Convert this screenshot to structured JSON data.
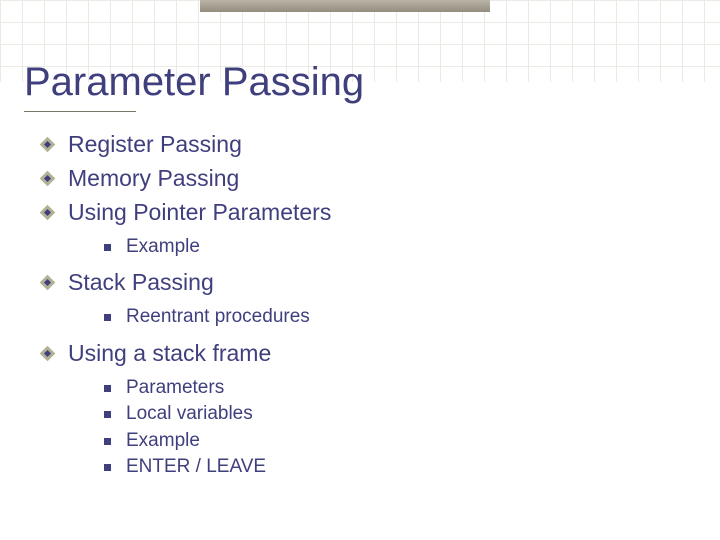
{
  "title": "Parameter Passing",
  "bullets": [
    {
      "label": "Register Passing",
      "children": []
    },
    {
      "label": "Memory Passing",
      "children": []
    },
    {
      "label": "Using Pointer Parameters",
      "children": [
        {
          "label": "Example"
        }
      ]
    },
    {
      "label": "Stack Passing",
      "children": [
        {
          "label": "Reentrant procedures"
        }
      ]
    },
    {
      "label": "Using a stack frame",
      "children": [
        {
          "label": "Parameters"
        },
        {
          "label": "Local variables"
        },
        {
          "label": "Example"
        },
        {
          "label": "ENTER / LEAVE"
        }
      ]
    }
  ]
}
